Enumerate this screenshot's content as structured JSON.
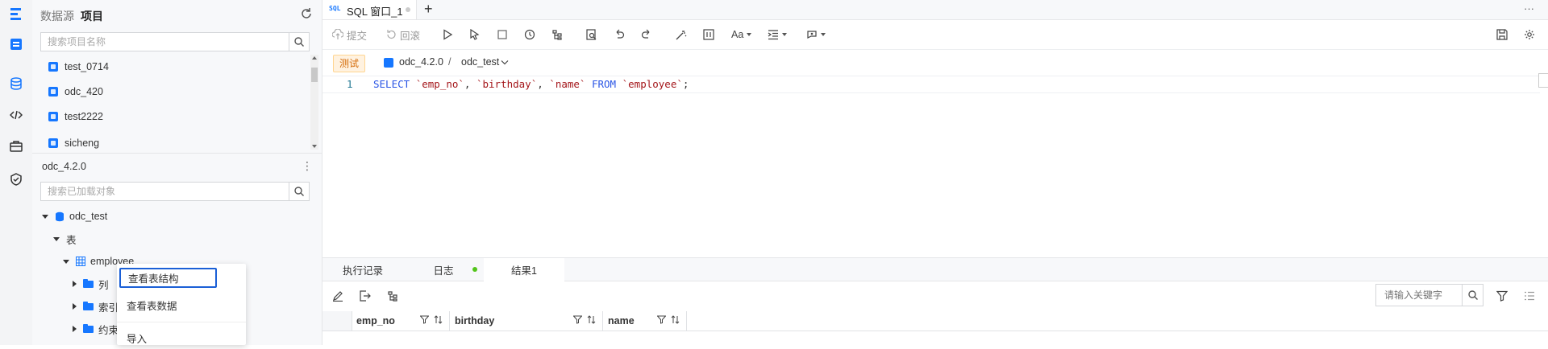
{
  "left_panel": {
    "tab_datasource": "数据源",
    "tab_project": "项目",
    "project_search_placeholder": "搜索项目名称",
    "projects": [
      "test_0714",
      "odc_420",
      "test2222",
      "sicheng"
    ],
    "datasource_name": "odc_4.2.0",
    "object_search_placeholder": "搜索已加载对象",
    "tree": {
      "database": "odc_test",
      "tables_node": "表",
      "table": "employee",
      "children": [
        "列",
        "索引",
        "约束"
      ]
    }
  },
  "context_menu": {
    "items": [
      "查看表结构",
      "查看表数据",
      "导入"
    ]
  },
  "editor": {
    "tab_sql_prefix": "SQL",
    "tab_title": "SQL 窗口_1",
    "more": "···",
    "toolbar": {
      "submit": "提交",
      "rollback": "回滚",
      "font_label": "Aa"
    },
    "env_badge": "测试",
    "datasource": "odc_4.2.0",
    "separator": "/",
    "database": "odc_test",
    "line_number": "1",
    "code_tokens": [
      {
        "t": "SELECT",
        "c": "kw"
      },
      {
        "t": " ",
        "c": "pn"
      },
      {
        "t": "`emp_no`",
        "c": "id"
      },
      {
        "t": ", ",
        "c": "pn"
      },
      {
        "t": "`birthday`",
        "c": "id"
      },
      {
        "t": ", ",
        "c": "pn"
      },
      {
        "t": "`name`",
        "c": "id"
      },
      {
        "t": " ",
        "c": "pn"
      },
      {
        "t": "FROM",
        "c": "kw"
      },
      {
        "t": " ",
        "c": "pn"
      },
      {
        "t": "`employee`",
        "c": "id"
      },
      {
        "t": ";",
        "c": "pn"
      }
    ]
  },
  "bottom": {
    "tabs": [
      "执行记录",
      "日志",
      "结果1"
    ],
    "active_tab": "结果1",
    "keyword_placeholder": "请输入关键字",
    "columns": [
      "emp_no",
      "birthday",
      "name"
    ]
  },
  "colors": {
    "brand": "#1677ff",
    "env_badge_bg": "#fff2e0",
    "env_badge_text": "#d46b08",
    "log_dot": "#52c41a"
  }
}
